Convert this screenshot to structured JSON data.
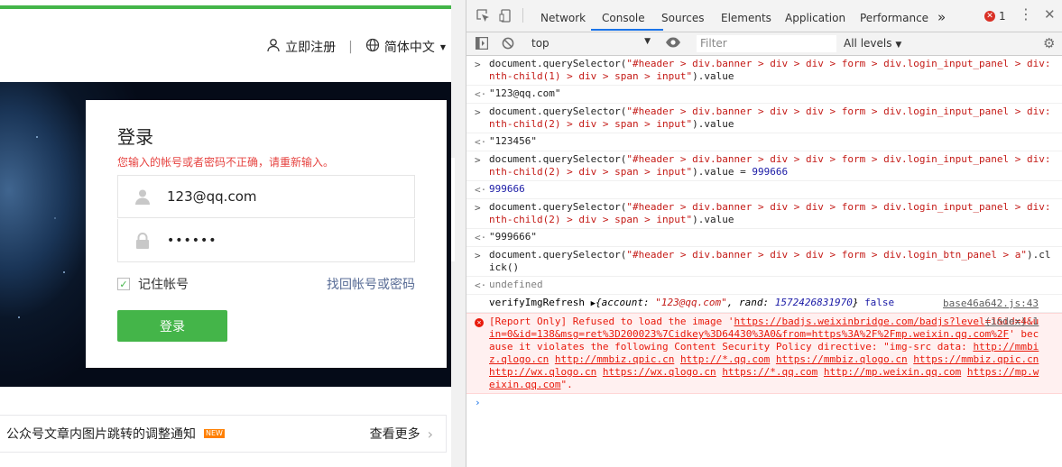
{
  "site": {
    "nav": {
      "register": "立即注册",
      "separator": "|",
      "language": "简体中文"
    },
    "login": {
      "title": "登录",
      "error": "您输入的帐号或者密码不正确，请重新输入。",
      "account_value": "123@qq.com",
      "password_mask": "••••••",
      "remember": "记住帐号",
      "forgot": "找回帐号或密码",
      "button": "登录"
    },
    "notice": {
      "text": "公众号文章内图片跳转的调整通知",
      "badge": "NEW",
      "more": "查看更多"
    },
    "colors": {
      "brand": "#44b549",
      "error": "#e64340",
      "link": "#576b95"
    }
  },
  "devtools": {
    "tabs": [
      "Network",
      "Console",
      "Sources",
      "Elements",
      "Application",
      "Performance"
    ],
    "active_tab": "Console",
    "overflow": "»",
    "error_count": "1",
    "context": "top",
    "filter_placeholder": "Filter",
    "levels": "All levels",
    "console": [
      {
        "cmd1": "document.querySelector(",
        "sel": "\"#header > div.banner > div > div > form > div.login_input_panel > div:nth-child(1) > div > span > input\"",
        "cmd2": ").value",
        "result": "\"123@qq.com\""
      },
      {
        "cmd1": "document.querySelector(",
        "sel": "\"#header > div.banner > div > div > form > div.login_input_panel > div:nth-child(2) > div > span > input\"",
        "cmd2": ").value",
        "result": "\"123456\""
      },
      {
        "cmd1": "document.querySelector(",
        "sel": "\"#header > div.banner > div > div > form > div.login_input_panel > div:nth-child(2) > div > span > input\"",
        "cmd2": ").value = ",
        "assign": "999666",
        "result": "999666"
      },
      {
        "cmd1": "document.querySelector(",
        "sel": "\"#header > div.banner > div > div > form > div.login_input_panel > div:nth-child(2) > div > span > input\"",
        "cmd2": ").value",
        "result": "\"999666\""
      },
      {
        "cmd1": "document.querySelector(",
        "sel": "\"#header > div.banner > div > div > form > div.login_btn_panel > a\"",
        "cmd2": ").click()",
        "result": "undefined"
      }
    ],
    "verify": {
      "name": "verifyImgRefresh ",
      "obj_open": "{account: ",
      "account": "\"123@qq.com\"",
      "mid": ", rand: ",
      "rand": "1572426831970",
      "obj_close": "}",
      "flag": "false",
      "source": "base46a642.js:43"
    },
    "error": {
      "lead": "[Report Only] Refused to load the image '",
      "url": "https://badjs.weixinbridge.com/badjs?level=1&id=4&uin=0&id=138&msg=ret%3D200023%7Cidkey%3D64430%3A0&from=https%3A%2F%2Fmp.weixin.qq.com%2F",
      "mid": "' because it violates the following Content Security Policy directive: \"img-src data: ",
      "hosts": [
        "http://mmbiz.qlogo.cn",
        "http://mmbiz.qpic.cn",
        "http://*.qq.com",
        "https://mmbiz.qlogo.cn",
        "https://mmbiz.qpic.cn",
        "http://wx.qlogo.cn",
        "https://wx.qlogo.cn",
        "https://*.qq.com",
        "http://mp.weixin.qq.com",
        "https://mp.weixin.qq.com"
      ],
      "tail": "\".",
      "source": "(index):1"
    },
    "prompt": "›"
  }
}
